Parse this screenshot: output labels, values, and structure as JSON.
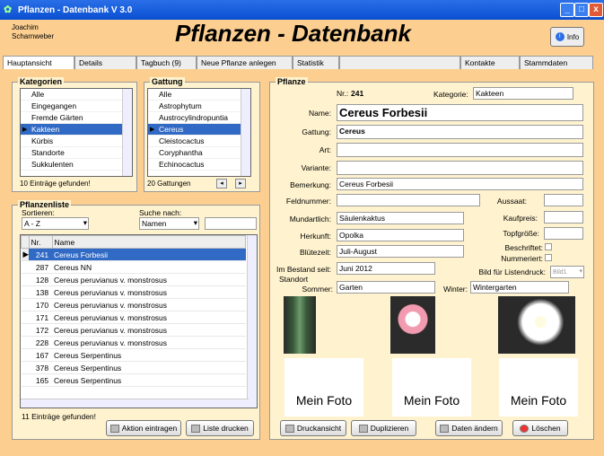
{
  "window": {
    "title": "Pflanzen - Datenbank V 3.0",
    "min": "_",
    "max": "□",
    "close": "x"
  },
  "header": {
    "user_line1": "Joachim",
    "user_line2": "Scharnweber",
    "title": "Pflanzen - Datenbank",
    "info_label": "Info"
  },
  "tabs": [
    "Hauptansicht",
    "Details",
    "Tagbuch (9)",
    "Neue Pflanze anlegen",
    "Statistik",
    "",
    "Kontakte",
    "Stammdaten"
  ],
  "kategorien": {
    "title": "Kategorien",
    "items": [
      "Alle",
      "Eingegangen",
      "Fremde Gärten",
      "Kakteen",
      "Kürbis",
      "Standorte",
      "Sukkulenten"
    ],
    "selected": 3,
    "count": "10 Einträge gefunden!"
  },
  "gattung": {
    "title": "Gattung",
    "items": [
      "Alle",
      "Astrophytum",
      "Austrocylindropuntia",
      "Cereus",
      "Cleistocactus",
      "Coryphantha",
      "Echinocactus"
    ],
    "selected": 3,
    "count": "20 Gattungen"
  },
  "pflanzenliste": {
    "title": "Pflanzenliste",
    "sort_label": "Sortieren:",
    "sort_value": "A - Z",
    "search_label": "Suche nach:",
    "search_value": "Namen",
    "search_text": "",
    "col_nr": "Nr.",
    "col_name": "Name",
    "rows": [
      [
        "241",
        "Cereus Forbesii"
      ],
      [
        "287",
        "Cereus NN"
      ],
      [
        "128",
        "Cereus peruvianus v. monstrosus"
      ],
      [
        "138",
        "Cereus peruvianus v. monstrosus"
      ],
      [
        "170",
        "Cereus peruvianus v. monstrosus"
      ],
      [
        "171",
        "Cereus peruvianus v. monstrosus"
      ],
      [
        "172",
        "Cereus peruvianus v. monstrosus"
      ],
      [
        "228",
        "Cereus peruvianus v. monstrosus"
      ],
      [
        "167",
        "Cereus Serpentinus"
      ],
      [
        "378",
        "Cereus Serpentinus"
      ],
      [
        "165",
        "Cereus Serpentinus"
      ]
    ],
    "selected": 0,
    "count": "11 Einträge gefunden!",
    "btn_action": "Aktion eintragen",
    "btn_print": "Liste drucken"
  },
  "pflanze": {
    "title": "Pflanze",
    "nr_label": "Nr.:",
    "nr": "241",
    "kategorie_label": "Kategorie:",
    "kategorie": "Kakteen",
    "name_label": "Name:",
    "name": "Cereus Forbesii",
    "gattung_label": "Gattung:",
    "gattung": "Cereus",
    "art_label": "Art:",
    "art": "",
    "variante_label": "Variante:",
    "variante": "",
    "bemerkung_label": "Bemerkung:",
    "bemerkung": "Cereus Forbesii",
    "feldnummer_label": "Feldnummer:",
    "feldnummer": "",
    "aussaat_label": "Aussaat:",
    "aussaat": "",
    "mundartlich_label": "Mundartlich:",
    "mundartlich": "Säulenkaktus",
    "kaufpreis_label": "Kaufpreis:",
    "kaufpreis": "",
    "herkunft_label": "Herkunft:",
    "herkunft": "Opolka",
    "topfgroesse_label": "Topfgröße:",
    "topfgroesse": "",
    "bluetezeit_label": "Blütezeit:",
    "bluetezeit": "Juli-August",
    "beschriftet_label": "Beschriftet:",
    "nummeriert_label": "Nummeriert:",
    "bestand_label": "Im Bestand seit:",
    "bestand": "Juni 2012",
    "bild_label": "Bild für Listendruck:",
    "bild_value": "Bild1",
    "standort_label": "Standort",
    "sommer_label": "Sommer:",
    "sommer": "Garten",
    "winter_label": "Winter:",
    "winter": "Wintergarten",
    "photo_label": "Mein Foto",
    "btn_druck": "Druckansicht",
    "btn_dup": "Duplizieren",
    "btn_aendern": "Daten ändern",
    "btn_loeschen": "Löschen"
  }
}
